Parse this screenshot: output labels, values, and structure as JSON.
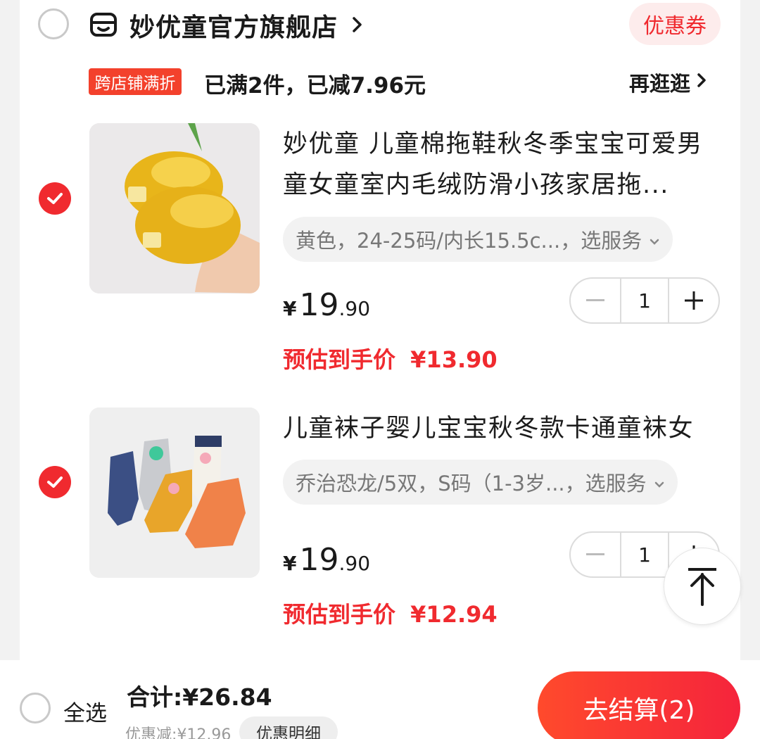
{
  "store": {
    "name": "妙优童官方旗舰店",
    "coupon_label": "优惠券",
    "promo_tag": "跨店铺满折",
    "promo_text": "已满2件，已减7.96元",
    "more_label": "再逛逛"
  },
  "items": [
    {
      "title": "妙优童 儿童棉拖鞋秋冬季宝宝可爱男童女童室内毛绒防滑小孩家居拖...",
      "spec": "黄色，24-25码/内长15.5c...，选服务",
      "price_currency": "¥",
      "price_int": "19",
      "price_dec": ".90",
      "estimated_label": "预估到手价",
      "estimated_price": "¥13.90",
      "quantity": "1",
      "checked": true
    },
    {
      "title": "儿童袜子婴儿宝宝秋冬款卡通童袜女",
      "spec": "乔治恐龙/5双，S码（1-3岁...，选服务",
      "price_currency": "¥",
      "price_int": "19",
      "price_dec": ".90",
      "estimated_label": "预估到手价",
      "estimated_price": "¥12.94",
      "quantity": "1",
      "checked": true
    }
  ],
  "footer": {
    "select_all": "全选",
    "total": "合计:¥26.84",
    "discount": "优惠减:¥12.96",
    "detail_label": "优惠明细",
    "checkout_label": "去结算(2)"
  },
  "colors": {
    "accent": "#f02a2f",
    "promo_tag_bg": "#f3412c",
    "coupon_bg": "#fdecec"
  },
  "icons": [
    "store-icon",
    "chevron-right-icon",
    "check-icon",
    "chevron-down-icon",
    "minus-icon",
    "plus-icon",
    "back-to-top-icon"
  ]
}
